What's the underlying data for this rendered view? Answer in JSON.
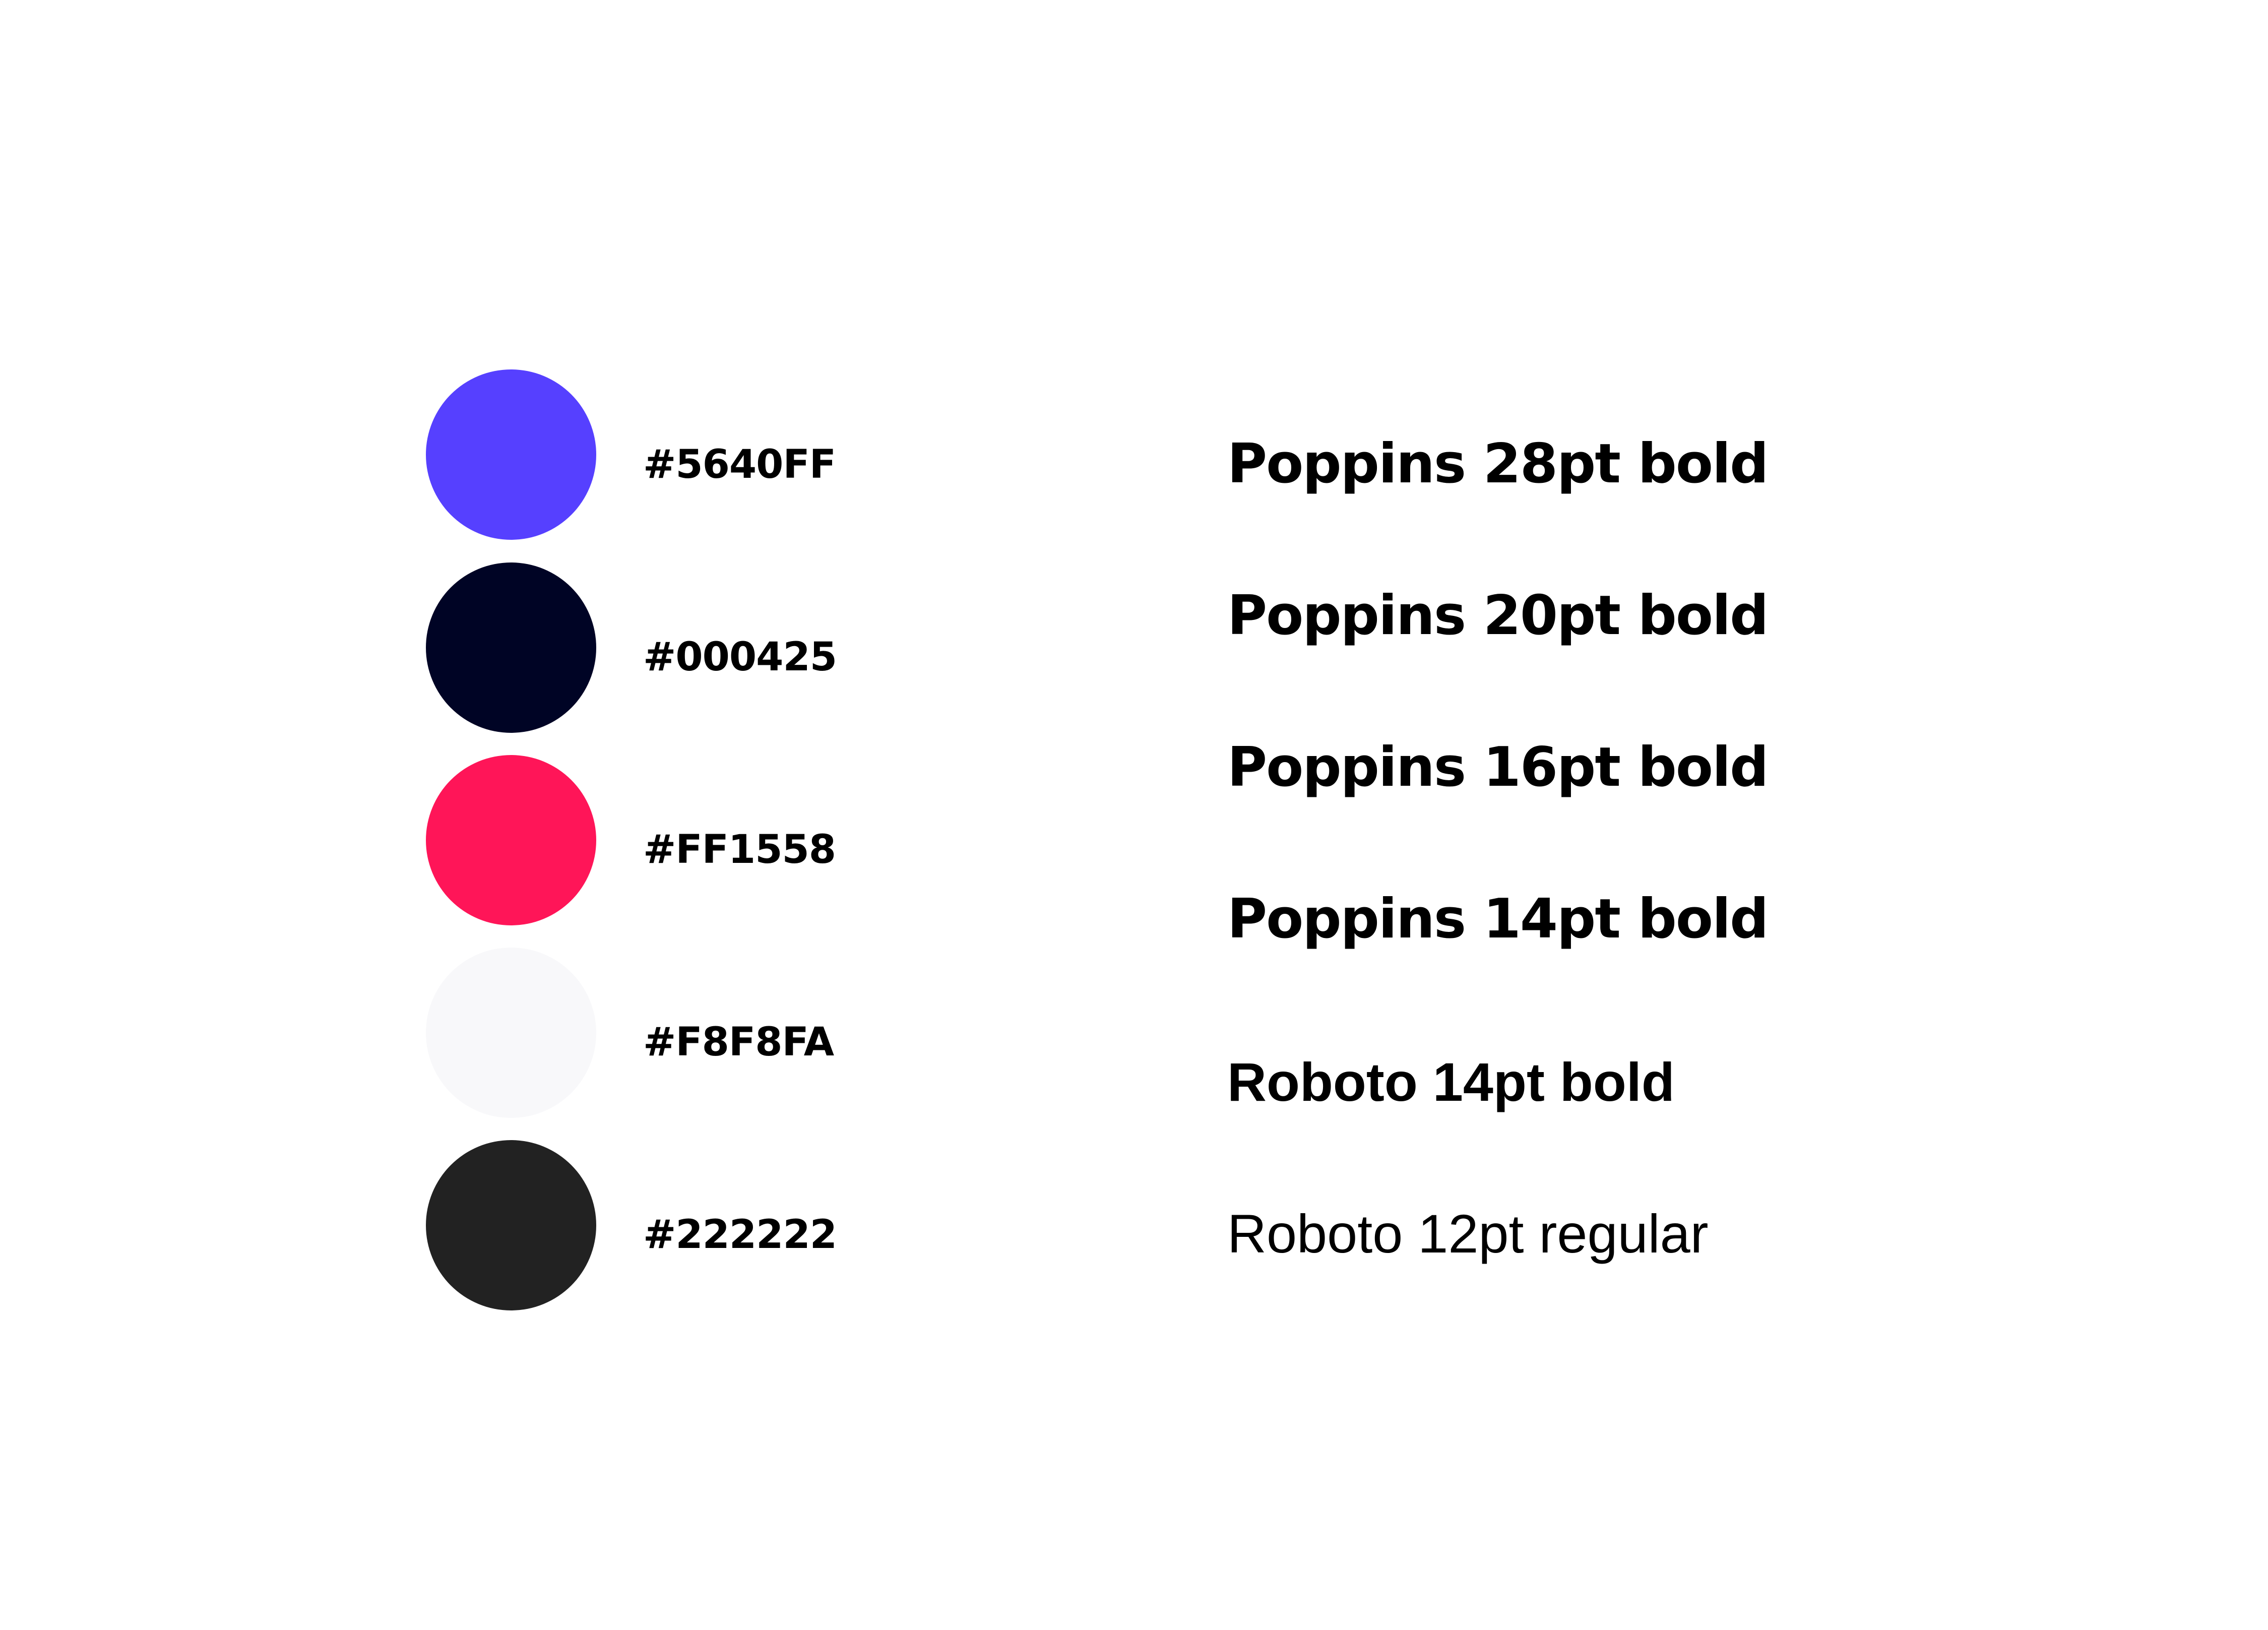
{
  "palette": {
    "colors": [
      {
        "hex": "#5640FF",
        "label": "#5640FF"
      },
      {
        "hex": "#000425",
        "label": "#000425"
      },
      {
        "hex": "#FF1558",
        "label": "#FF1558"
      },
      {
        "hex": "#F8F8FA",
        "label": "#F8F8FA"
      },
      {
        "hex": "#222222",
        "label": "#222222"
      }
    ]
  },
  "typography": {
    "samples": [
      {
        "label": "Poppins 28pt bold"
      },
      {
        "label": "Poppins 20pt bold"
      },
      {
        "label": "Poppins 16pt bold"
      },
      {
        "label": "Poppins 14pt bold"
      },
      {
        "label": "Roboto 14pt bold"
      },
      {
        "label": "Roboto 12pt regular"
      }
    ]
  }
}
